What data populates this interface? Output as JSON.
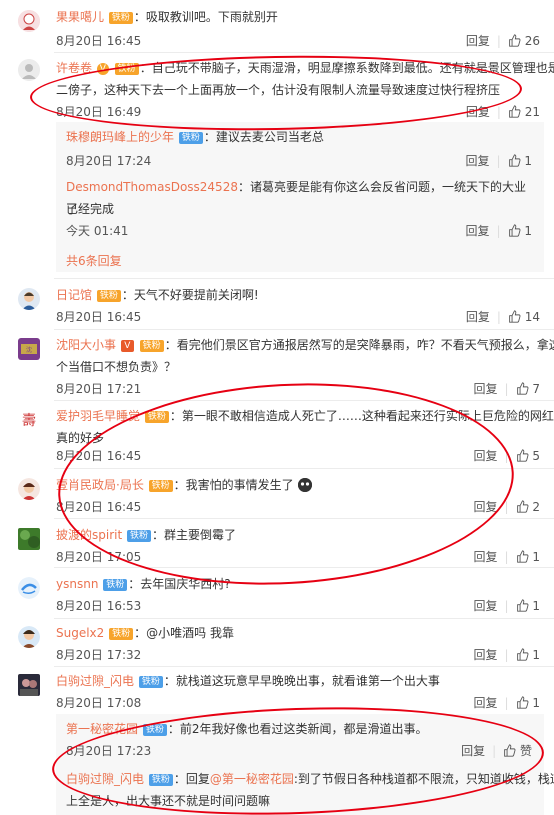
{
  "comments": [
    {
      "user": "果果噶儿",
      "badge": "铁粉",
      "text": "：吸取教训吧。下雨就别开",
      "time": "8月20日 16:45",
      "reply": "回复",
      "likes": "26"
    },
    {
      "user": "许卷卷",
      "badge": "铁粉",
      "text": "：自己玩不带脑子，天雨湿滑，明显摩擦系数降到最低。还有就是景区管理也是",
      "text2": "二傍子，这种天下去一个上面再放一个，估计没有限制人流量导致速度过快行程挤压",
      "time": "8月20日 16:49",
      "reply": "回复",
      "likes": "21"
    },
    {
      "user": "日记馆",
      "badge": "铁粉",
      "text": "：天气不好要提前关闭啊!",
      "time": "8月20日 16:45",
      "reply": "回复",
      "likes": "14"
    },
    {
      "user": "沈阳大小事",
      "badge": "铁粉",
      "text": "：看完他们景区官方通报居然写的是突降暴雨，咋？不看天气预报么，拿这",
      "text2": "个当借口不想负责》？",
      "time": "8月20日 17:21",
      "reply": "回复",
      "likes": "7"
    },
    {
      "user": "爱护羽毛早睡觉",
      "badge": "铁粉",
      "text": "：第一眼不敢相信造成人死亡了……这种看起来还行实际上巨危险的网红设施",
      "text2": "真的好多",
      "time": "8月20日 16:45",
      "reply": "回复",
      "likes": "5"
    },
    {
      "user": "壹肖民政局·局长",
      "badge": "铁粉",
      "text": "：我害怕的事情发生了",
      "time": "8月20日 16:45",
      "reply": "回复",
      "likes": "2"
    },
    {
      "user": "披渡的spirit",
      "badge": "铁粉",
      "text": "：群主要倒霉了",
      "time": "8月20日 17:05",
      "reply": "回复",
      "likes": "1"
    },
    {
      "user": "ysnsnn",
      "badge": "铁粉",
      "text": "：去年国庆华西村?",
      "time": "8月20日 16:53",
      "reply": "回复",
      "likes": "1"
    },
    {
      "user": "Sugelx2",
      "badge": "铁粉",
      "text": "：@小唯酒吗 我靠",
      "time": "8月20日 17:32",
      "reply": "回复",
      "likes": "1"
    },
    {
      "user": "白驹过隙_闪电",
      "badge": "铁粉",
      "text": "：就栈道这玩意早早晚晚出事，就看谁第一个出大事",
      "time": "8月20日 17:08",
      "reply": "回复",
      "likes": "1"
    }
  ],
  "replies_block1": [
    {
      "user": "珠穆朗玛峰上的少年",
      "badge": "铁粉",
      "text": "：建议去麦公司当老总",
      "time": "8月20日 17:24",
      "reply": "回复",
      "likes": "1"
    },
    {
      "user": "DesmondThomasDoss24528",
      "text": "：诸葛亮要是能有你这么会反省问题，一统天下的大业已经完成",
      "text2": "了",
      "time": "今天 01:41",
      "reply": "回复",
      "likes": "1"
    }
  ],
  "more_replies": "共6条回复",
  "replies_block2": [
    {
      "user": "第一秘密花园",
      "badge": "铁粉",
      "text": "：前2年我好像也看过这类新闻，都是滑道出事。",
      "time": "8月20日 17:23",
      "reply": "回复",
      "likes": "赞"
    },
    {
      "user": "白驹过隙_闪电",
      "badge": "铁粉",
      "text": "：回复",
      "mention": "@第一秘密花园",
      "text_b": ":到了节假日各种栈道都不限流，只知道收钱，栈道",
      "text2": "上全是人，出大事还不就是时间问题嘛"
    }
  ],
  "colors": {
    "name": "#eb7350",
    "circle": "#e60012",
    "badge_gold": "#f7a42b",
    "badge_blue": "#4d9fe8"
  }
}
